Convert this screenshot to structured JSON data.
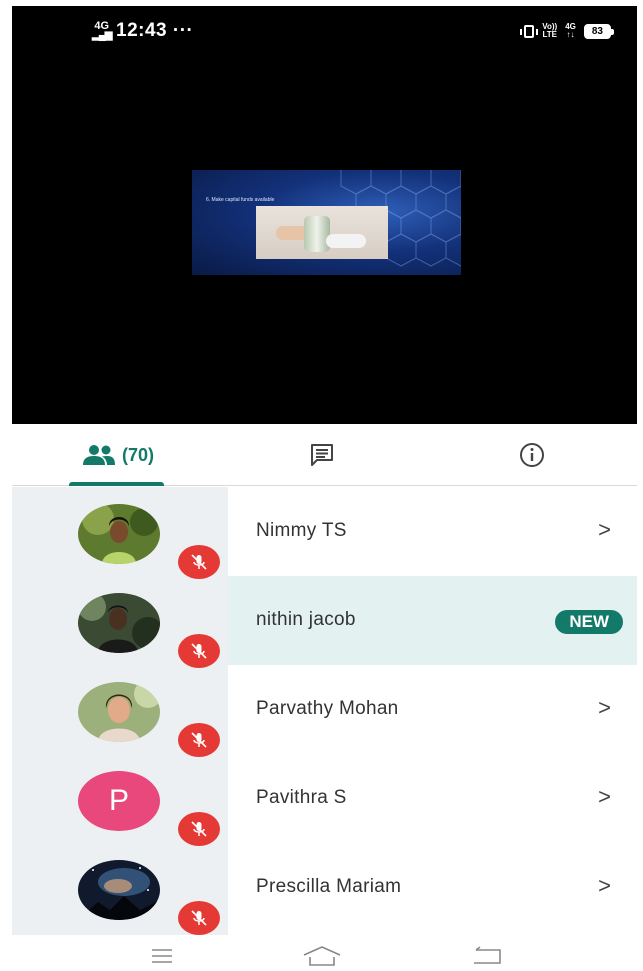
{
  "status_bar": {
    "network_type": "4G",
    "time": "12:43",
    "more_indicator": "···",
    "volte_top": "Vo))",
    "volte_bottom": "LTE",
    "network_top": "4G",
    "network_bottom": "↑↓",
    "battery": "83"
  },
  "presentation": {
    "slide_caption": "6. Make capital funds available"
  },
  "tabs": {
    "participants_count": "(70)",
    "items": [
      {
        "name": "participants",
        "icon": "people-icon"
      },
      {
        "name": "chat",
        "icon": "chat-icon"
      },
      {
        "name": "info",
        "icon": "info-icon"
      }
    ]
  },
  "participants": [
    {
      "name": "Nimmy TS",
      "trailing": ">",
      "muted": true,
      "avatar": "photo"
    },
    {
      "name": "nithin jacob",
      "trailing": "NEW",
      "muted": true,
      "avatar": "photo"
    },
    {
      "name": "Parvathy Mohan",
      "trailing": ">",
      "muted": true,
      "avatar": "photo"
    },
    {
      "name": "Pavithra S",
      "trailing": ">",
      "muted": true,
      "avatar": "letter",
      "initial": "P"
    },
    {
      "name": "Prescilla Mariam",
      "trailing": ">",
      "muted": true,
      "avatar": "photo"
    }
  ],
  "colors": {
    "accent": "#137a69",
    "mic_muted": "#e53935",
    "letter_avatar": "#e8487c",
    "highlight_row": "#e3f2f1"
  }
}
